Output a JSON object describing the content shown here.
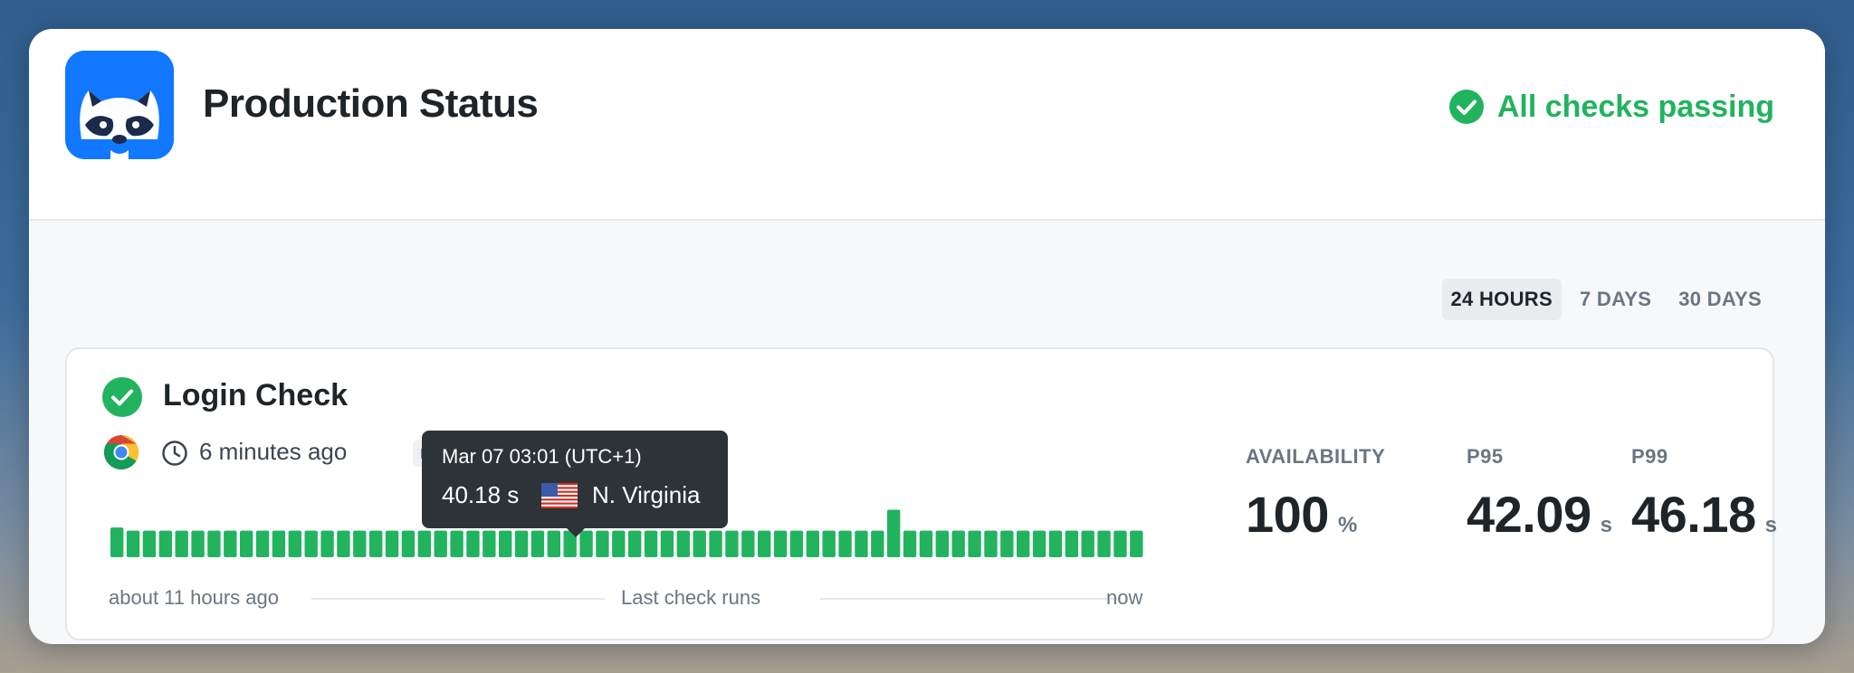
{
  "header": {
    "title": "Production Status",
    "status_text": "All checks passing",
    "status_color": "#22b35e"
  },
  "range_tabs": [
    {
      "label": "24 HOURS",
      "active": true
    },
    {
      "label": "7 DAYS",
      "active": false
    },
    {
      "label": "30 DAYS",
      "active": false
    }
  ],
  "check": {
    "name": "Login Check",
    "browser_icon": "chrome-icon",
    "last_run": "6 minutes ago",
    "tag": "mis",
    "bars": {
      "count": 64,
      "color": "#22b35e",
      "normal_level": 0.42,
      "spike_index": 48,
      "spike_level": 0.75,
      "first_level": 0.47
    },
    "axis": {
      "start": "about 11 hours ago",
      "middle": "Last check runs",
      "end": "now"
    },
    "tooltip": {
      "date": "Mar 07 03:01 (UTC+1)",
      "value": "40.18 s",
      "flag_icon": "us-flag-icon",
      "region": "N. Virginia"
    },
    "metrics": [
      {
        "label": "AVAILABILITY",
        "value": "100",
        "unit": "%"
      },
      {
        "label": "P95",
        "value": "42.09",
        "unit": "s"
      },
      {
        "label": "P99",
        "value": "46.18",
        "unit": "s"
      }
    ]
  }
}
